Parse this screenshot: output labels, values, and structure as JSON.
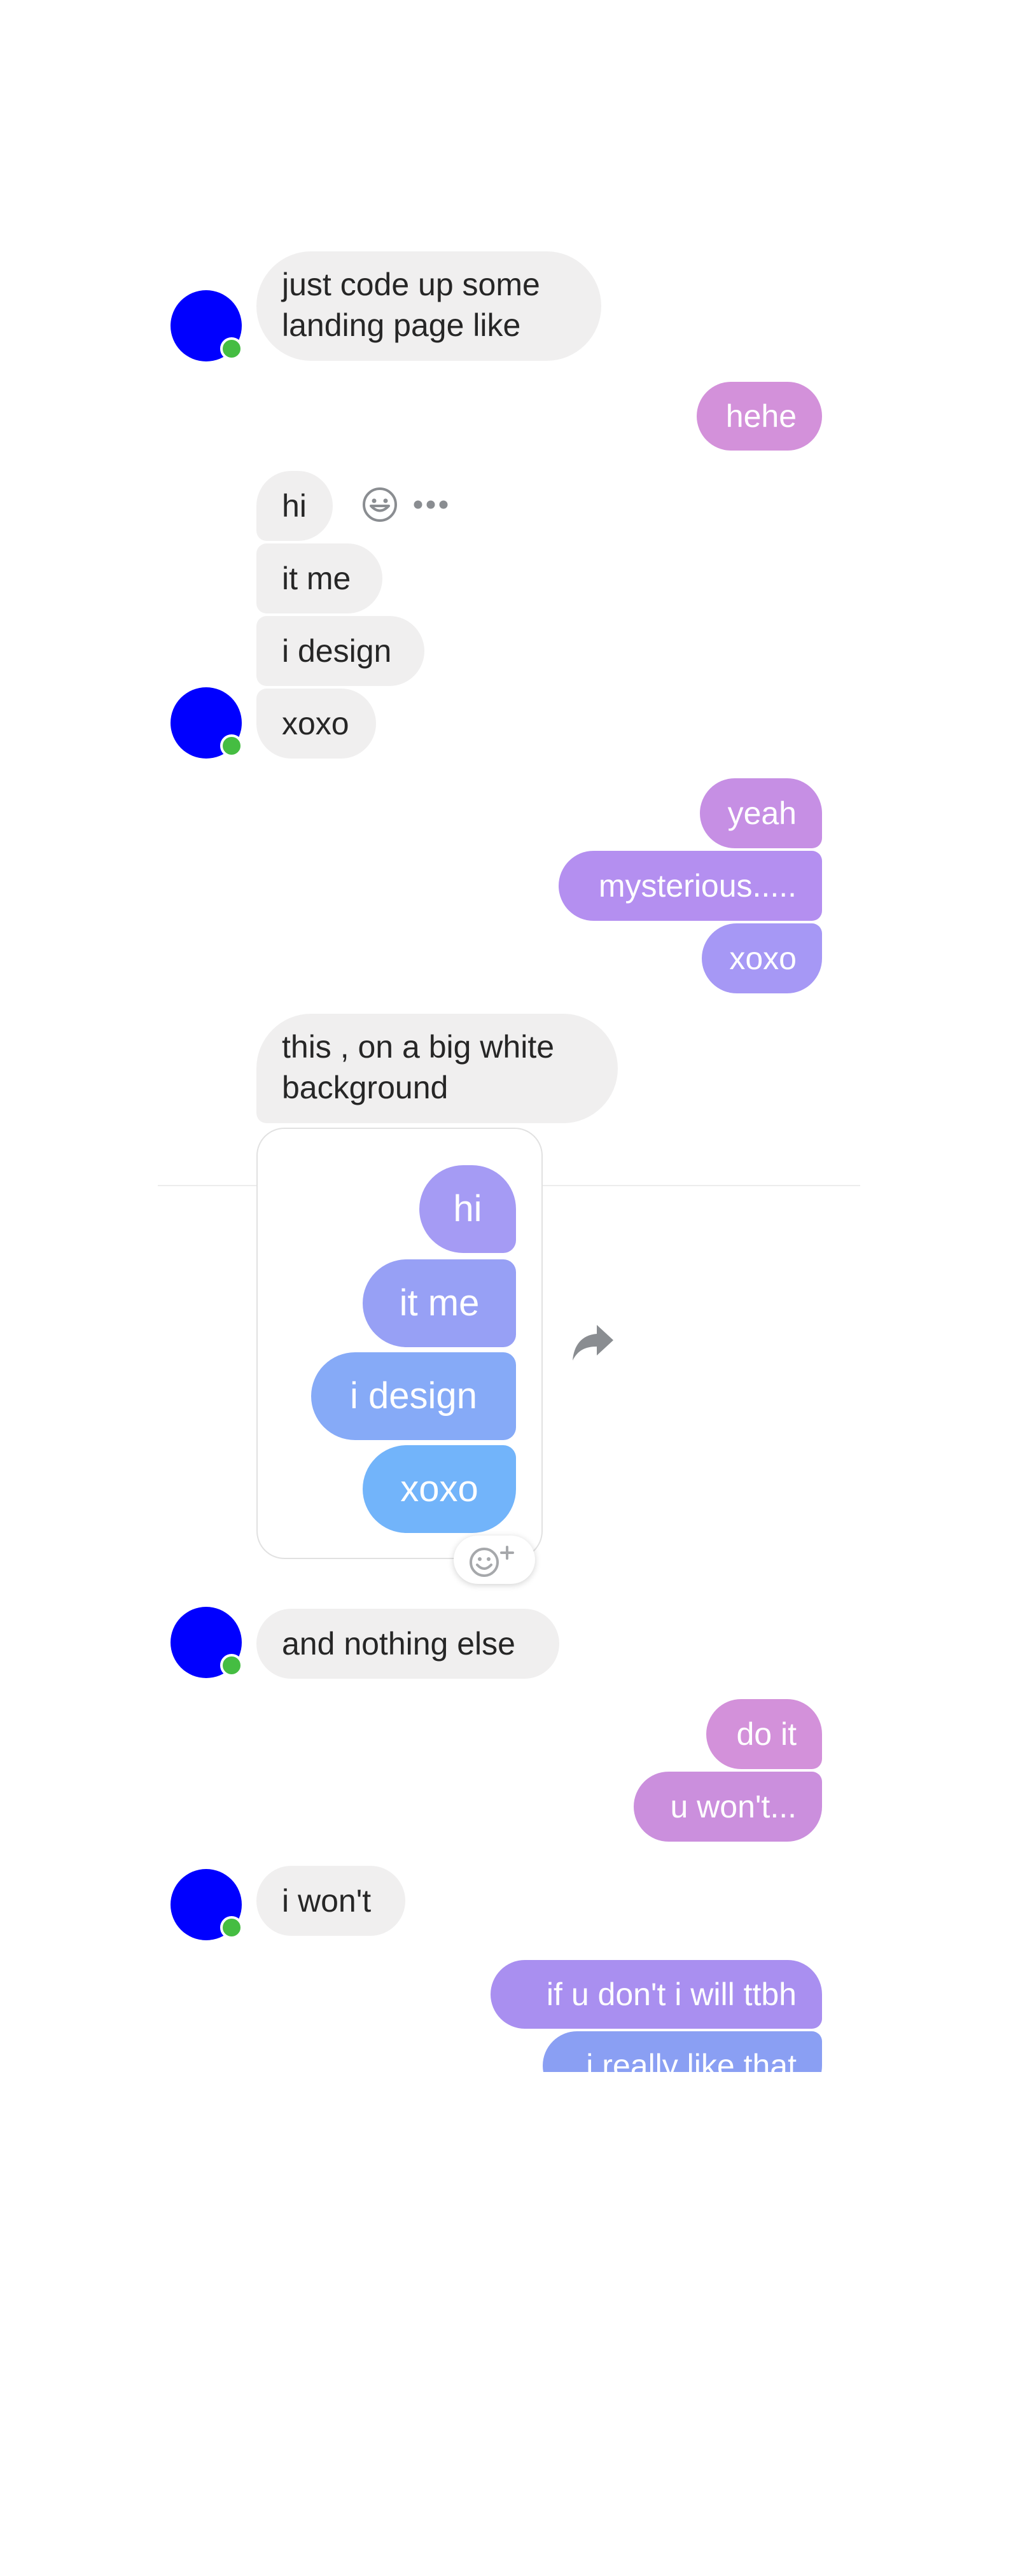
{
  "conversation": {
    "group_1": [
      "just code up some",
      "landing page like"
    ],
    "reply_1": "hehe",
    "group_2": [
      "hi",
      "it me",
      "i design",
      "xoxo"
    ],
    "reply_2": [
      "yeah",
      "mysterious.....",
      "xoxo"
    ],
    "group_3": [
      "this , on a big white",
      "background"
    ],
    "shared_image": [
      "hi",
      "it me",
      "i design",
      "xoxo"
    ],
    "group_4": "and nothing else",
    "reply_3": [
      "do it",
      "u won't..."
    ],
    "group_5": "i won't",
    "reply_4": [
      "if u don't i will ttbh",
      "i really like that"
    ]
  },
  "icons": {
    "message_react": "smiley-icon",
    "message_more": "more-dots-icon",
    "share": "share-arrow-icon",
    "add_reaction": "add-reaction-icon"
  },
  "colors": {
    "avatar": "#0000ff",
    "presence": "#45bd42",
    "incoming_bubble": "#f0efef",
    "outgoing_gradient": [
      "#d391da",
      "#c68fe4",
      "#a98ff0",
      "#8a9ff3",
      "#72aef9"
    ]
  }
}
